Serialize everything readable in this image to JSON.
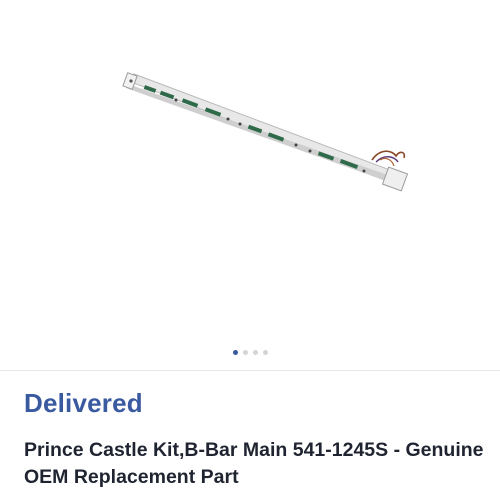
{
  "product": {
    "image_icon": "product-photo",
    "image_dots": [
      true,
      false,
      false,
      false
    ],
    "status": "Delivered",
    "title": "Prince Castle Kit,B-Bar Main 541-1245S - Genuine OEM Replacement Part"
  },
  "colors": {
    "status": "#3a5aa0",
    "title": "#1f2430",
    "dot_active": "#3a5aa0",
    "dot_inactive": "#d4d4d4"
  }
}
